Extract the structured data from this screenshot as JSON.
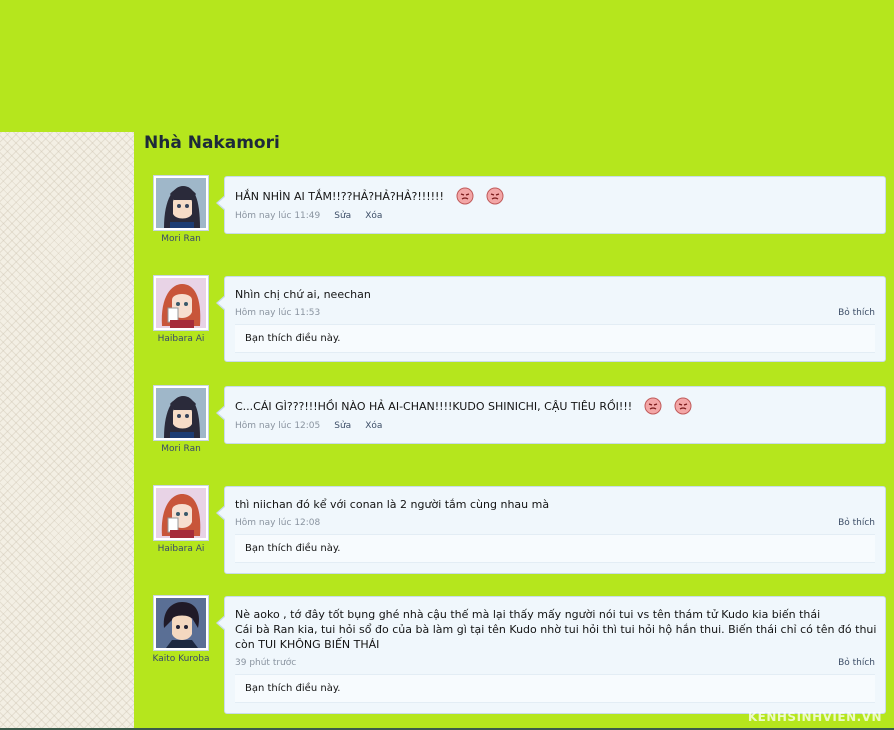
{
  "page": {
    "title": "Nhà Nakamori"
  },
  "posts": [
    {
      "username": "Mori Ran",
      "avatar": "mori-ran",
      "message": "HẮN NHÌN AI TẮM!!??HẢ?HẢ?HẢ?!!!!!!",
      "smileys": 2,
      "time": "Hôm nay lúc 11:49",
      "edit_label": "Sửa",
      "delete_label": "Xóa"
    },
    {
      "username": "Haibara Ai",
      "avatar": "haibara-ai",
      "message": "Nhìn chị chứ ai, neechan",
      "time": "Hôm nay lúc 11:53",
      "like_label": "Bỏ thích",
      "likes_text": "Bạn thích điều này."
    },
    {
      "username": "Mori Ran",
      "avatar": "mori-ran",
      "message": "C...CÁI GÌ???!!!HỒI NÀO HẢ AI-CHAN!!!!KUDO SHINICHI, CẬU TIÊU RỒI!!!",
      "smileys": 2,
      "time": "Hôm nay lúc 12:05",
      "edit_label": "Sửa",
      "delete_label": "Xóa"
    },
    {
      "username": "Haibara Ai",
      "avatar": "haibara-ai",
      "message": "thì niichan đó kể với conan là 2 người tắm cùng nhau mà",
      "time": "Hôm nay lúc 12:08",
      "like_label": "Bỏ thích",
      "likes_text": "Bạn thích điều này."
    },
    {
      "username": "Kaito Kuroba",
      "avatar": "kaito-kuroba",
      "message_lines": [
        "Nè aoko , tớ đây tốt bụng ghé nhà cậu thế mà lại thấy mấy người nói tui vs tên thám tử Kudo kia biến thái",
        "Cái bà Ran kia, tui hỏi sổ đo của bà làm gì tại tên Kudo nhờ tui hỏi thì tui hỏi hộ hắn thui. Biến thái chỉ có tên đó thui",
        "còn TUI KHÔNG BIẾN THÁI"
      ],
      "time": "39 phút trước",
      "like_label": "Bỏ thích",
      "likes_text": "Bạn thích điều này."
    }
  ],
  "watermark": "KENHSINHVIEN.VN",
  "colors": {
    "background": "#b5e61d",
    "bubble": "#f0f7fc",
    "bubble_border": "#c9dcea"
  }
}
